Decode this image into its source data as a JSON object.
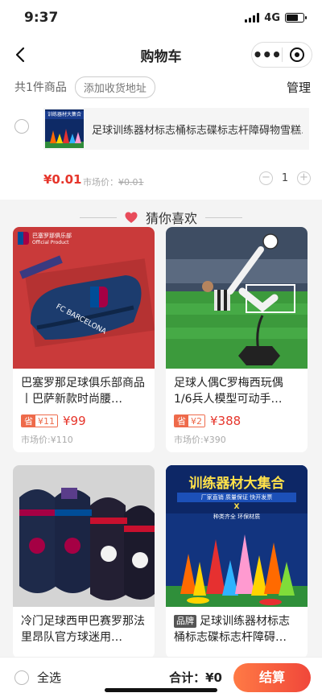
{
  "status_bar": {
    "time": "9:37",
    "network": "4G"
  },
  "nav": {
    "title": "购物车"
  },
  "cart_header": {
    "count_label": "共1件商品",
    "add_address": "添加收货地址",
    "manage": "管理"
  },
  "cart_item": {
    "thumb_text": "训练器材大集合",
    "title": "足球训练器材标志桶标志碟标志杆障碍物雪糕…",
    "price": "¥0.01",
    "market_prefix": "市场价：",
    "market_price": "¥0.01",
    "minus": "−",
    "quantity": "1",
    "plus": "+"
  },
  "guess": {
    "title": "猜你喜欢"
  },
  "products": [
    {
      "name": "巴塞罗那足球俱乐部商品丨巴萨新款时尚腰…",
      "save_label": "省",
      "save_amount": "¥11",
      "price": "¥99",
      "market": "市场价:¥110",
      "img_text_1": "巴塞罗那俱乐部",
      "img_text_2": "Official Product",
      "img_text_3": "FC BARCELONA"
    },
    {
      "name": "足球人偶C罗梅西玩偶1/6兵人模型可动手…",
      "save_label": "省",
      "save_amount": "¥2",
      "price": "¥388",
      "market": "市场价:¥390"
    },
    {
      "name": "冷门足球西甲巴赛罗那法里昂队官方球迷用…"
    },
    {
      "brand": "品牌",
      "name": "足球训练器材标志桶标志碟标志杆障碍…",
      "img_title": "训练器材大集合",
      "img_tags": "厂家直销  质量保证  快开发票",
      "img_x": "X",
      "img_sub": "种类齐全 环保材质"
    }
  ],
  "bottom_bar": {
    "select_all": "全选",
    "total": "合计：¥0",
    "checkout": "结算"
  },
  "colors": {
    "accent_red": "#e6352b",
    "checkout_start": "#ff7a45",
    "checkout_end": "#f0473a"
  }
}
